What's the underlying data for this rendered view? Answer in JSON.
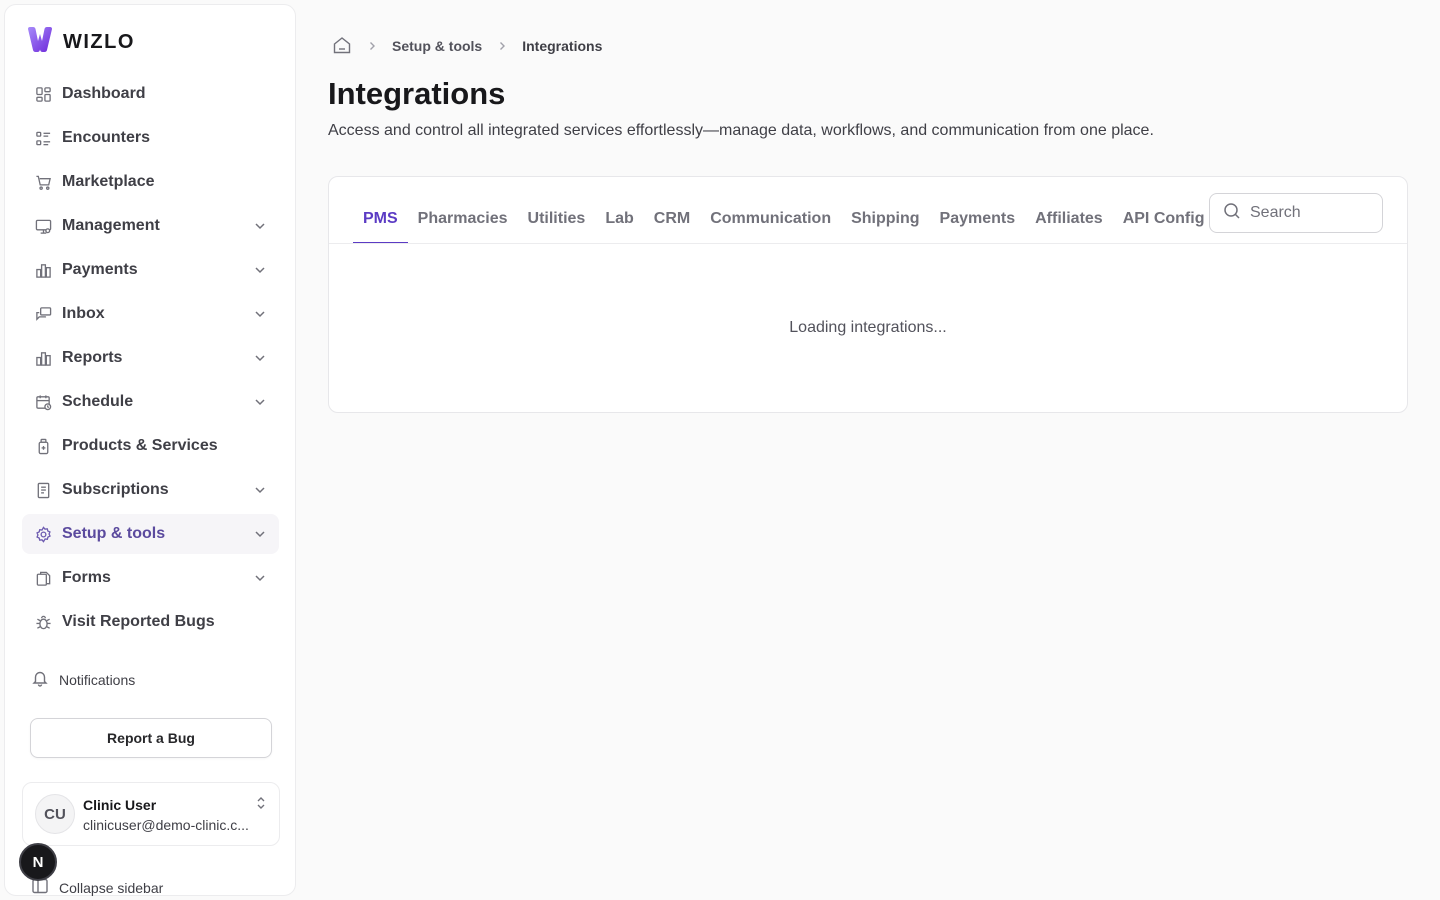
{
  "brand": {
    "name": "WIZLO"
  },
  "sidebar": {
    "items": [
      {
        "label": "Dashboard",
        "icon": "dashboard-grid-icon",
        "expandable": false
      },
      {
        "label": "Encounters",
        "icon": "list-icon",
        "expandable": false
      },
      {
        "label": "Marketplace",
        "icon": "cart-icon",
        "expandable": false
      },
      {
        "label": "Management",
        "icon": "monitor-icon",
        "expandable": true
      },
      {
        "label": "Payments",
        "icon": "bar-chart-icon",
        "expandable": true
      },
      {
        "label": "Inbox",
        "icon": "chat-icon",
        "expandable": true
      },
      {
        "label": "Reports",
        "icon": "bar-chart-icon",
        "expandable": true
      },
      {
        "label": "Schedule",
        "icon": "calendar-clock-icon",
        "expandable": true
      },
      {
        "label": "Products & Services",
        "icon": "bottle-icon",
        "expandable": false
      },
      {
        "label": "Subscriptions",
        "icon": "receipt-icon",
        "expandable": true
      },
      {
        "label": "Setup & tools",
        "icon": "gear-icon",
        "expandable": true,
        "active": true
      },
      {
        "label": "Forms",
        "icon": "copy-icon",
        "expandable": true
      },
      {
        "label": "Visit Reported Bugs",
        "icon": "bug-icon",
        "expandable": false
      }
    ],
    "notifications_label": "Notifications",
    "report_bug_label": "Report a Bug",
    "user": {
      "initials": "CU",
      "name": "Clinic User",
      "email": "clinicuser@demo-clinic.c..."
    },
    "badge_letter": "N",
    "collapse_label": "Collapse sidebar"
  },
  "breadcrumb": {
    "items": [
      "Setup & tools",
      "Integrations"
    ]
  },
  "page": {
    "title": "Integrations",
    "description": "Access and control all integrated services effortlessly—manage data, workflows, and communication from one place."
  },
  "tabs": {
    "items": [
      "PMS",
      "Pharmacies",
      "Utilities",
      "Lab",
      "CRM",
      "Communication",
      "Shipping",
      "Payments",
      "Affiliates",
      "API Config"
    ],
    "active_index": 0
  },
  "search": {
    "placeholder": "Search",
    "value": ""
  },
  "status": {
    "loading_text": "Loading integrations..."
  },
  "colors": {
    "accent": "#5b3bc4",
    "active_nav_text": "#5b4a9e",
    "logo_gradient_start": "#8b5cf6",
    "logo_gradient_end": "#6d28d9"
  }
}
